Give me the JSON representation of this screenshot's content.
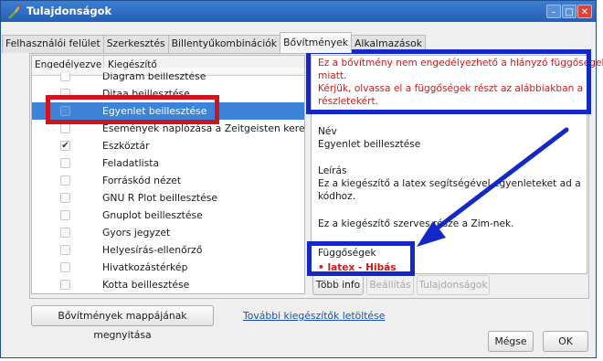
{
  "window": {
    "title": "Tulajdonságok",
    "min_glyph": "–",
    "max_glyph": "□",
    "close_glyph": "✕"
  },
  "tabs": [
    {
      "label": "Felhasználói felület"
    },
    {
      "label": "Szerkesztés"
    },
    {
      "label": "Billentyűkombinációk"
    },
    {
      "label": "Bővítmények",
      "active": true
    },
    {
      "label": "Alkalmazások"
    }
  ],
  "list": {
    "col_enabled": "Engedélyezve",
    "col_plugin": "Kiegészítő",
    "rows": [
      {
        "label": "Diagram beillesztése",
        "checked": false,
        "check_glyph": ""
      },
      {
        "label": "Ditaa beillesztése",
        "checked": false,
        "check_glyph": ""
      },
      {
        "label": "Egyenlet beillesztése",
        "checked": false,
        "selected": true,
        "check_glyph": ""
      },
      {
        "label": "Események naplózása a Zeitgeisten keresztül",
        "checked": false,
        "check_glyph": ""
      },
      {
        "label": "Eszköztár",
        "checked": true,
        "check_glyph": "✔"
      },
      {
        "label": "Feladatlista",
        "checked": false,
        "check_glyph": ""
      },
      {
        "label": "Forráskód nézet",
        "checked": false,
        "check_glyph": ""
      },
      {
        "label": "GNU R Plot beillesztése",
        "checked": false,
        "check_glyph": ""
      },
      {
        "label": "Gnuplot beillesztése",
        "checked": false,
        "check_glyph": ""
      },
      {
        "label": "Gyors jegyzet",
        "checked": false,
        "check_glyph": ""
      },
      {
        "label": "Helyesírás-ellenőrző",
        "checked": false,
        "check_glyph": ""
      },
      {
        "label": "Hivatkozástérkép",
        "checked": false,
        "check_glyph": ""
      },
      {
        "label": "Kotta beillesztése",
        "checked": false,
        "check_glyph": ""
      }
    ]
  },
  "info": {
    "warning_line1": "Ez a bővítmény nem engedélyezhető a hiányzó függőségek",
    "warning_line2": "miatt.",
    "warning_line3": "Kérjük, olvassa el a függőségek részt az alábbiakban a",
    "warning_line4": "részletekért.",
    "name_heading": "Név",
    "name_value": "Egyenlet beillesztése",
    "desc_heading": "Leírás",
    "desc_line1": "Ez a kiegészítő a latex segítségével egyenleteket ad a",
    "desc_line2": "kódhoz.",
    "core_note": "Ez a kiegészítő szerves része a Zim-nek.",
    "deps_heading": "Függőségek",
    "deps_item": "• latex - Hibás"
  },
  "panel_buttons": {
    "more_info": "Több info",
    "configure": "Beállítás",
    "properties": "Tulajdonságok"
  },
  "footer": {
    "open_folder": "Bővítmények mappájának megnyitása",
    "download_link": "További kiegészítők letöltése",
    "cancel": "Mégse",
    "ok": "OK"
  },
  "colors": {
    "highlight_red": "#d0141e",
    "highlight_blue": "#1428c8",
    "selection": "#3d83d9",
    "error_text": "#d01a1a"
  }
}
